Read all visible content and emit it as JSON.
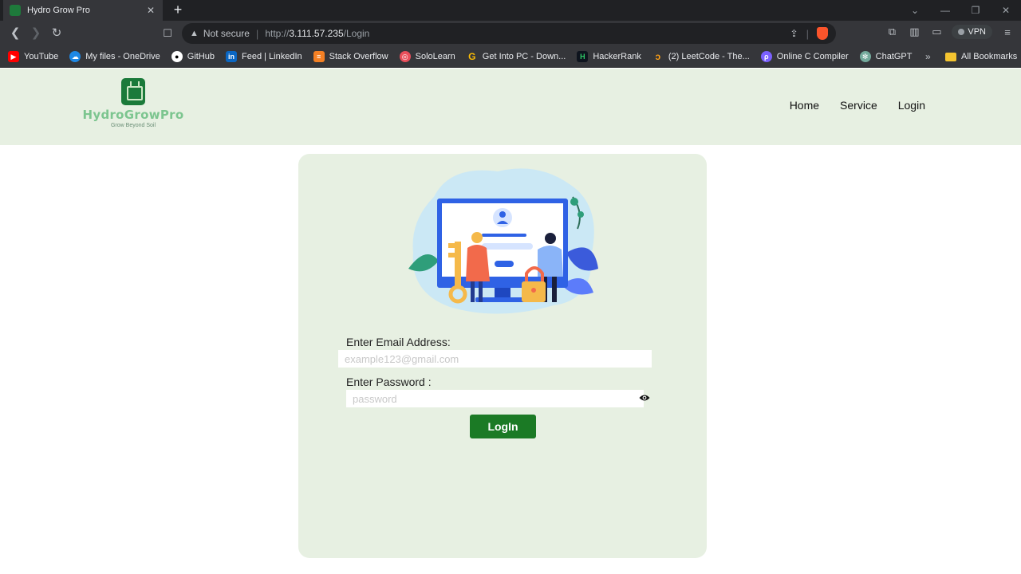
{
  "browser": {
    "tab_title": "Hydro Grow Pro",
    "security_label": "Not secure",
    "url_scheme": "http://",
    "url_host": "3.111.57.235",
    "url_path": "/Login",
    "vpn_label": "VPN",
    "bookmarks": [
      {
        "label": "YouTube",
        "icon": "youtube-icon",
        "color": "#ff0000"
      },
      {
        "label": "My files - OneDrive",
        "icon": "onedrive-icon",
        "color": "#1e88e5"
      },
      {
        "label": "GitHub",
        "icon": "github-icon",
        "color": "#ffffff"
      },
      {
        "label": "Feed | LinkedIn",
        "icon": "linkedin-icon",
        "color": "#0a66c2"
      },
      {
        "label": "Stack Overflow",
        "icon": "stackoverflow-icon",
        "color": "#f48024"
      },
      {
        "label": "SoloLearn",
        "icon": "sololearn-icon",
        "color": "#e94f5b"
      },
      {
        "label": "Get Into PC - Down...",
        "icon": "getintopc-icon",
        "color": "#fbbc05"
      },
      {
        "label": "HackerRank",
        "icon": "hackerrank-icon",
        "color": "#2ec866"
      },
      {
        "label": "(2) LeetCode - The...",
        "icon": "leetcode-icon",
        "color": "#ffa116"
      },
      {
        "label": "Online C Compiler",
        "icon": "compiler-icon",
        "color": "#7b61ff"
      },
      {
        "label": "ChatGPT",
        "icon": "chatgpt-icon",
        "color": "#74aa9c"
      }
    ],
    "all_bookmarks_label": "All Bookmarks"
  },
  "header": {
    "logo_text": "HydroGrowPro",
    "logo_tagline": "Grow Beyond Soil",
    "nav": [
      "Home",
      "Service",
      "Login"
    ]
  },
  "login": {
    "email_label": "Enter Email Address:",
    "email_placeholder": "example123@gmail.com",
    "password_label": "Enter Password :",
    "password_placeholder": "password",
    "submit_label": "LogIn"
  },
  "colors": {
    "header_bg": "#e7f0e2",
    "card_bg": "#e7f0e2",
    "button_bg": "#1b7a25",
    "brand_green": "#7cc58f"
  }
}
